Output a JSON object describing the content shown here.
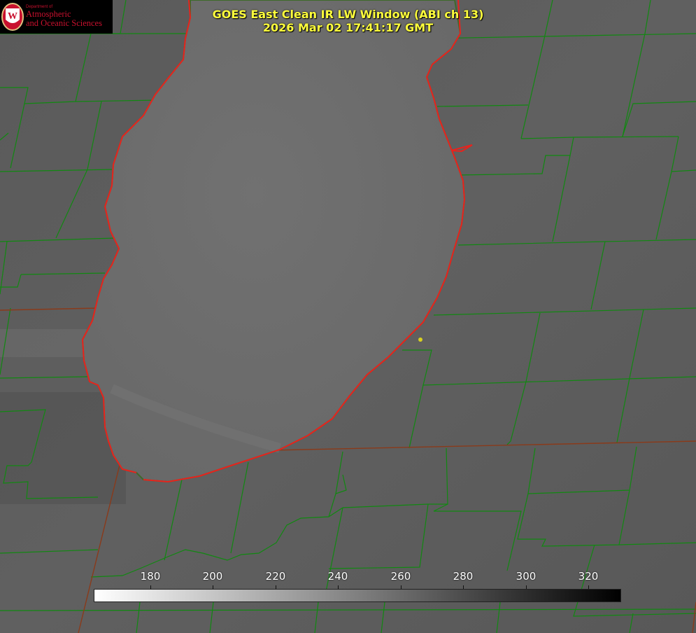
{
  "title": {
    "line1": "GOES East Clean IR LW Window (ABI ch 13)",
    "line2": "2026 Mar 02 17:41:17 GMT"
  },
  "logo": {
    "dept_line": "Department of",
    "line1": "Atmospheric",
    "line2": "and Oceanic Sciences",
    "emblem_letter": "W",
    "brand_color": "#c8102e"
  },
  "colorbar": {
    "tick_labels": [
      "180",
      "200",
      "220",
      "240",
      "260",
      "280",
      "300",
      "320"
    ],
    "gradient_start": "#ffffff",
    "gradient_end": "#000000"
  },
  "colors": {
    "county_lines": "#118811",
    "state_lines": "#8a3a1a",
    "shoreline_red": "#e8231d",
    "title_text": "#ffff3c",
    "marker": "#d8d020",
    "lake": "#6c6c6c",
    "land": "#5f5f5f"
  }
}
